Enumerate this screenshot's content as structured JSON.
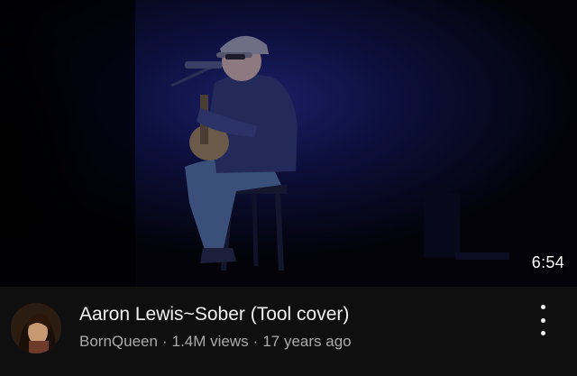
{
  "video": {
    "duration": "6:54",
    "thumbnail_icon": "concert-performer-thumbnail",
    "title": "Aaron Lewis~Sober (Tool cover)",
    "channel": "BornQueen",
    "views": "1.4M views",
    "age": "17 years ago",
    "separator": "·"
  },
  "menu": {
    "icon": "more-vert-icon"
  },
  "colors": {
    "background": "#0f0f0f",
    "title": "#f1f1f1",
    "subtitle": "#aaaaaa"
  }
}
